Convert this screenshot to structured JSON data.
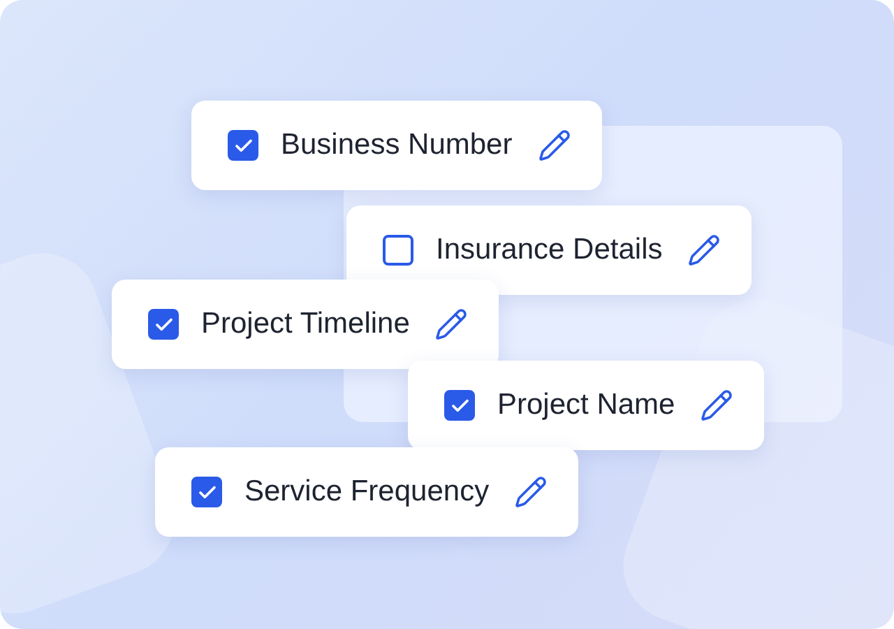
{
  "fields": [
    {
      "label": "Business Number",
      "checked": true
    },
    {
      "label": "Insurance Details",
      "checked": false
    },
    {
      "label": "Project Timeline",
      "checked": true
    },
    {
      "label": "Project Name",
      "checked": true
    },
    {
      "label": "Service Frequency",
      "checked": true
    }
  ]
}
